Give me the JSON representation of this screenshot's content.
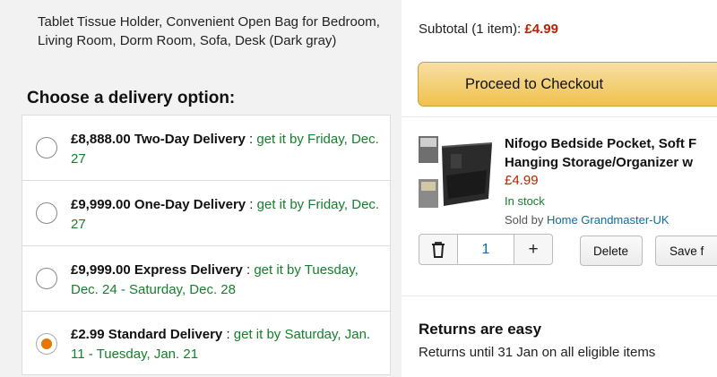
{
  "product": {
    "description": "Tablet Tissue Holder, Convenient Open Bag for Bedroom, Living Room, Dorm Room, Sofa, Desk (Dark gray)"
  },
  "delivery": {
    "heading": "Choose a delivery option:",
    "separator": ":",
    "options": [
      {
        "price_name": "£8,888.00 Two-Day Delivery",
        "eta": "get it by Friday, Dec. 27",
        "selected": false
      },
      {
        "price_name": "£9,999.00 One-Day Delivery",
        "eta": "get it by Friday, Dec. 27",
        "selected": false
      },
      {
        "price_name": "£9,999.00 Express Delivery",
        "eta": "get it by Tuesday, Dec. 24 - Saturday, Dec. 28",
        "selected": false
      },
      {
        "price_name": "£2.99 Standard Delivery",
        "eta": "get it by Saturday, Jan. 11 - Tuesday, Jan. 21",
        "selected": true
      }
    ]
  },
  "cart": {
    "subtotal_label": "Subtotal (1 item):",
    "subtotal_amount": "£4.99",
    "checkout_label": "Proceed to Checkout",
    "item": {
      "title_line1": "Nifogo Bedside Pocket, Soft F",
      "title_line2": "Hanging Storage/Organizer w",
      "price": "£4.99",
      "stock": "In stock",
      "seller_prefix": "Sold by",
      "seller_name": "Home Grandmaster-UK",
      "quantity": "1",
      "plus_symbol": "+",
      "delete_label": "Delete",
      "save_label": "Save f"
    }
  },
  "returns": {
    "title": "Returns are easy",
    "text": "Returns until 31 Jan on all eligible items"
  },
  "colors": {
    "price_red": "#b12704",
    "eta_green": "#15802c",
    "radio_orange": "#e77600",
    "checkout_yellow": "#f0c14b",
    "link_blue": "#0a6da4"
  },
  "icons": {
    "trash": "trash-icon",
    "radio_selected": "radio-selected-icon",
    "radio_empty": "radio-empty-icon"
  }
}
